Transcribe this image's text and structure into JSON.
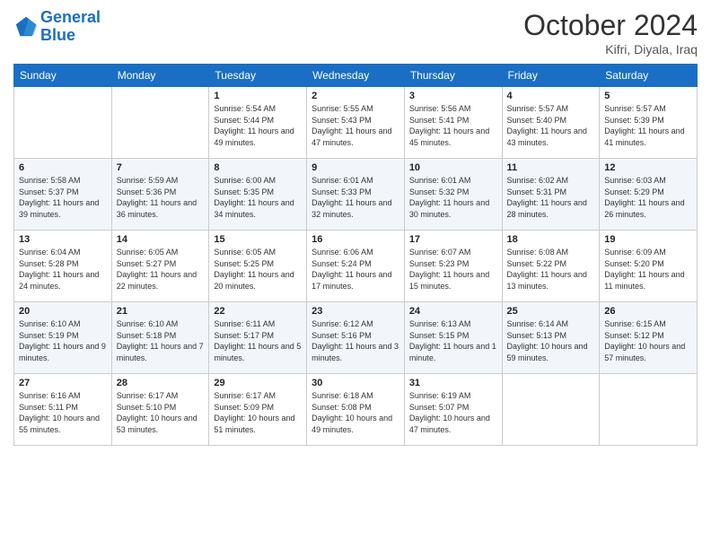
{
  "header": {
    "logo_line1": "General",
    "logo_line2": "Blue",
    "month": "October 2024",
    "location": "Kifri, Diyala, Iraq"
  },
  "days_of_week": [
    "Sunday",
    "Monday",
    "Tuesday",
    "Wednesday",
    "Thursday",
    "Friday",
    "Saturday"
  ],
  "weeks": [
    [
      {
        "day": "",
        "info": ""
      },
      {
        "day": "",
        "info": ""
      },
      {
        "day": "1",
        "info": "Sunrise: 5:54 AM\nSunset: 5:44 PM\nDaylight: 11 hours and 49 minutes."
      },
      {
        "day": "2",
        "info": "Sunrise: 5:55 AM\nSunset: 5:43 PM\nDaylight: 11 hours and 47 minutes."
      },
      {
        "day": "3",
        "info": "Sunrise: 5:56 AM\nSunset: 5:41 PM\nDaylight: 11 hours and 45 minutes."
      },
      {
        "day": "4",
        "info": "Sunrise: 5:57 AM\nSunset: 5:40 PM\nDaylight: 11 hours and 43 minutes."
      },
      {
        "day": "5",
        "info": "Sunrise: 5:57 AM\nSunset: 5:39 PM\nDaylight: 11 hours and 41 minutes."
      }
    ],
    [
      {
        "day": "6",
        "info": "Sunrise: 5:58 AM\nSunset: 5:37 PM\nDaylight: 11 hours and 39 minutes."
      },
      {
        "day": "7",
        "info": "Sunrise: 5:59 AM\nSunset: 5:36 PM\nDaylight: 11 hours and 36 minutes."
      },
      {
        "day": "8",
        "info": "Sunrise: 6:00 AM\nSunset: 5:35 PM\nDaylight: 11 hours and 34 minutes."
      },
      {
        "day": "9",
        "info": "Sunrise: 6:01 AM\nSunset: 5:33 PM\nDaylight: 11 hours and 32 minutes."
      },
      {
        "day": "10",
        "info": "Sunrise: 6:01 AM\nSunset: 5:32 PM\nDaylight: 11 hours and 30 minutes."
      },
      {
        "day": "11",
        "info": "Sunrise: 6:02 AM\nSunset: 5:31 PM\nDaylight: 11 hours and 28 minutes."
      },
      {
        "day": "12",
        "info": "Sunrise: 6:03 AM\nSunset: 5:29 PM\nDaylight: 11 hours and 26 minutes."
      }
    ],
    [
      {
        "day": "13",
        "info": "Sunrise: 6:04 AM\nSunset: 5:28 PM\nDaylight: 11 hours and 24 minutes."
      },
      {
        "day": "14",
        "info": "Sunrise: 6:05 AM\nSunset: 5:27 PM\nDaylight: 11 hours and 22 minutes."
      },
      {
        "day": "15",
        "info": "Sunrise: 6:05 AM\nSunset: 5:25 PM\nDaylight: 11 hours and 20 minutes."
      },
      {
        "day": "16",
        "info": "Sunrise: 6:06 AM\nSunset: 5:24 PM\nDaylight: 11 hours and 17 minutes."
      },
      {
        "day": "17",
        "info": "Sunrise: 6:07 AM\nSunset: 5:23 PM\nDaylight: 11 hours and 15 minutes."
      },
      {
        "day": "18",
        "info": "Sunrise: 6:08 AM\nSunset: 5:22 PM\nDaylight: 11 hours and 13 minutes."
      },
      {
        "day": "19",
        "info": "Sunrise: 6:09 AM\nSunset: 5:20 PM\nDaylight: 11 hours and 11 minutes."
      }
    ],
    [
      {
        "day": "20",
        "info": "Sunrise: 6:10 AM\nSunset: 5:19 PM\nDaylight: 11 hours and 9 minutes."
      },
      {
        "day": "21",
        "info": "Sunrise: 6:10 AM\nSunset: 5:18 PM\nDaylight: 11 hours and 7 minutes."
      },
      {
        "day": "22",
        "info": "Sunrise: 6:11 AM\nSunset: 5:17 PM\nDaylight: 11 hours and 5 minutes."
      },
      {
        "day": "23",
        "info": "Sunrise: 6:12 AM\nSunset: 5:16 PM\nDaylight: 11 hours and 3 minutes."
      },
      {
        "day": "24",
        "info": "Sunrise: 6:13 AM\nSunset: 5:15 PM\nDaylight: 11 hours and 1 minute."
      },
      {
        "day": "25",
        "info": "Sunrise: 6:14 AM\nSunset: 5:13 PM\nDaylight: 10 hours and 59 minutes."
      },
      {
        "day": "26",
        "info": "Sunrise: 6:15 AM\nSunset: 5:12 PM\nDaylight: 10 hours and 57 minutes."
      }
    ],
    [
      {
        "day": "27",
        "info": "Sunrise: 6:16 AM\nSunset: 5:11 PM\nDaylight: 10 hours and 55 minutes."
      },
      {
        "day": "28",
        "info": "Sunrise: 6:17 AM\nSunset: 5:10 PM\nDaylight: 10 hours and 53 minutes."
      },
      {
        "day": "29",
        "info": "Sunrise: 6:17 AM\nSunset: 5:09 PM\nDaylight: 10 hours and 51 minutes."
      },
      {
        "day": "30",
        "info": "Sunrise: 6:18 AM\nSunset: 5:08 PM\nDaylight: 10 hours and 49 minutes."
      },
      {
        "day": "31",
        "info": "Sunrise: 6:19 AM\nSunset: 5:07 PM\nDaylight: 10 hours and 47 minutes."
      },
      {
        "day": "",
        "info": ""
      },
      {
        "day": "",
        "info": ""
      }
    ]
  ]
}
